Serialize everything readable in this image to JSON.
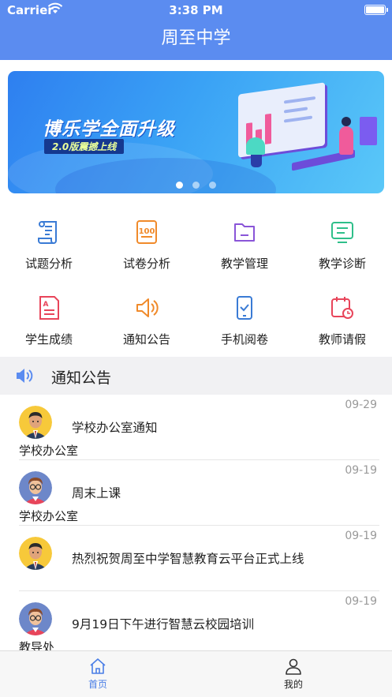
{
  "status_bar": {
    "carrier": "Carrier",
    "time": "3:38 PM"
  },
  "nav": {
    "title": "周至中学"
  },
  "banner": {
    "headline": "博乐学全面升级",
    "tagline": "2.0版震撼上线",
    "slide_count": 3,
    "active_slide": 1
  },
  "grid": {
    "items": [
      {
        "label": "试题分析",
        "icon": "scroll-icon",
        "color": "#3a7bd5"
      },
      {
        "label": "试卷分析",
        "icon": "score-paper-icon",
        "color": "#f08a2a"
      },
      {
        "label": "教学管理",
        "icon": "folder-icon",
        "color": "#8a55d8"
      },
      {
        "label": "教学诊断",
        "icon": "monitor-icon",
        "color": "#2fbf8a"
      },
      {
        "label": "学生成绩",
        "icon": "grade-report-icon",
        "color": "#e8455a"
      },
      {
        "label": "通知公告",
        "icon": "speaker-icon",
        "color": "#f08a2a"
      },
      {
        "label": "手机阅卷",
        "icon": "phone-check-icon",
        "color": "#3a7bd5"
      },
      {
        "label": "教师请假",
        "icon": "calendar-clock-icon",
        "color": "#e8455a"
      }
    ]
  },
  "notice_section": {
    "title": "通知公告",
    "icon": "speaker-icon",
    "accent": "#5b8cf0"
  },
  "notices": [
    {
      "date": "09-29",
      "text": "学校办公室通知",
      "from": "学校办公室",
      "avatar": "man-yellow"
    },
    {
      "date": "09-19",
      "text": "周末上课",
      "from": "学校办公室",
      "avatar": "boy-glasses-blue"
    },
    {
      "date": "09-19",
      "text": "热烈祝贺周至中学智慧教育云平台正式上线",
      "from": "",
      "avatar": "man-yellow"
    },
    {
      "date": "09-19",
      "text": "9月19日下午进行智慧云校园培训",
      "from": "教导处",
      "avatar": "boy-glasses-blue"
    }
  ],
  "tab_bar": {
    "tabs": [
      {
        "label": "首页",
        "icon": "home-icon",
        "active": true
      },
      {
        "label": "我的",
        "icon": "user-icon",
        "active": false
      }
    ],
    "active_color": "#4a7ee6"
  }
}
